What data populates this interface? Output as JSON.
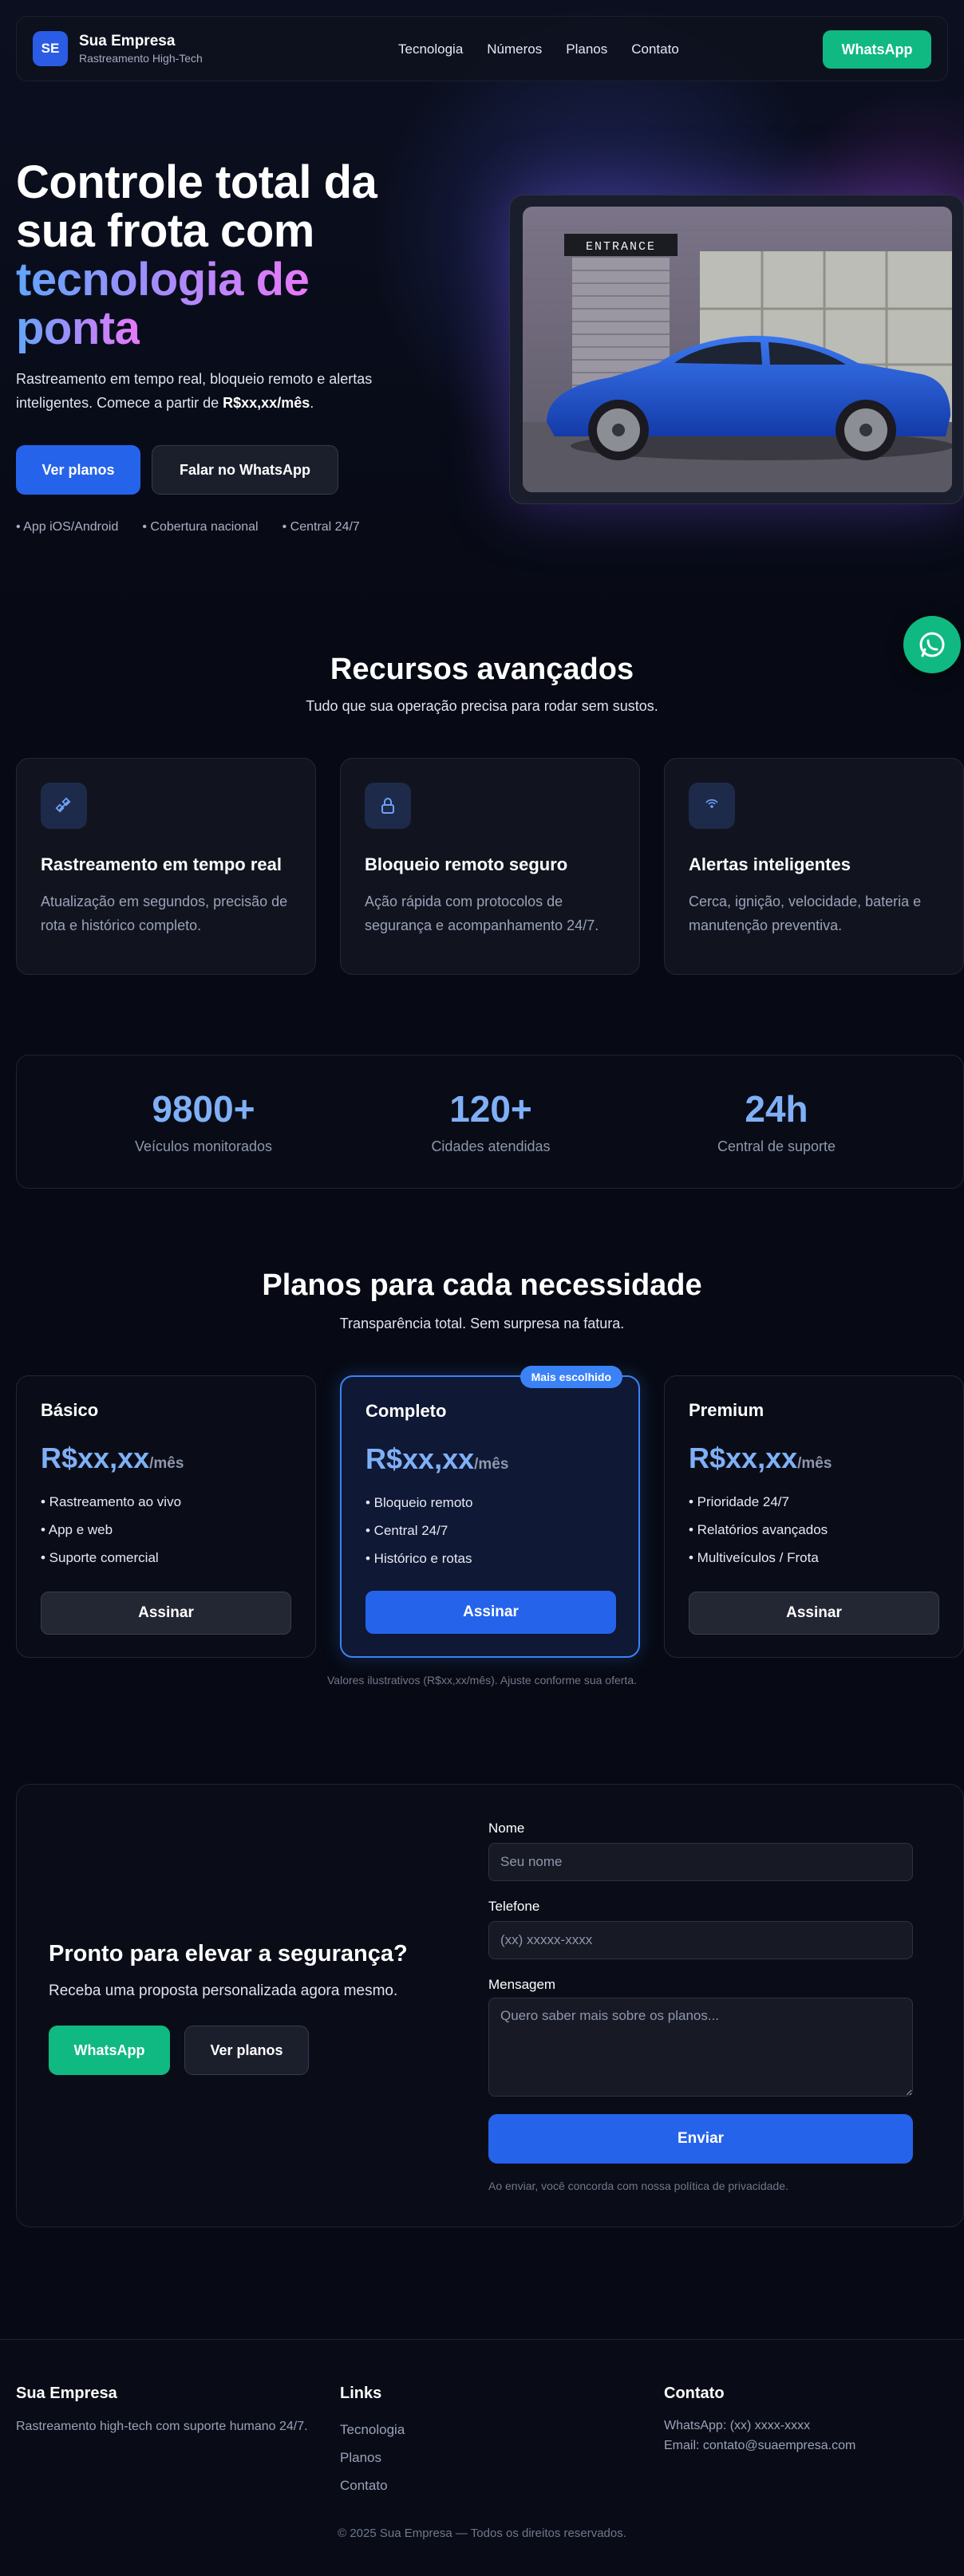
{
  "nav": {
    "logo_initials": "SE",
    "brand_name": "Sua Empresa",
    "brand_sub": "Rastreamento High-Tech",
    "links": [
      "Tecnologia",
      "Números",
      "Planos",
      "Contato"
    ],
    "whatsapp_label": "WhatsApp"
  },
  "hero": {
    "title_line1": "Controle total da",
    "title_line2": "sua frota com",
    "title_grad1": "tecnologia de",
    "title_grad2": "ponta",
    "desc_before": "Rastreamento em tempo real, bloqueio remoto e alertas inteligentes. Comece a partir de ",
    "desc_price": "R$xx,xx/mês",
    "desc_after": ".",
    "primary_btn": "Ver planos",
    "secondary_btn": "Falar no WhatsApp",
    "badges": [
      "• App iOS/Android",
      "• Cobertura nacional",
      "• Central 24/7"
    ],
    "image_sign": "ENTRANCE"
  },
  "features": {
    "title": "Recursos avançados",
    "subtitle": "Tudo que sua operação precisa para rodar sem sustos.",
    "items": [
      {
        "title": "Rastreamento em tempo real",
        "desc": "Atualização em segundos, precisão de rota e histórico completo.",
        "icon": "satellite-icon"
      },
      {
        "title": "Bloqueio remoto seguro",
        "desc": "Ação rápida com protocolos de segurança e acompanhamento 24/7.",
        "icon": "lock-icon"
      },
      {
        "title": "Alertas inteligentes",
        "desc": "Cerca, ignição, velocidade, bateria e manutenção preventiva.",
        "icon": "signal-icon"
      }
    ]
  },
  "stats": [
    {
      "value": "9800+",
      "label": "Veículos monitorados"
    },
    {
      "value": "120+",
      "label": "Cidades atendidas"
    },
    {
      "value": "24h",
      "label": "Central de suporte"
    }
  ],
  "plans": {
    "title": "Planos para cada necessidade",
    "subtitle": "Transparência total. Sem surpresa na fatura.",
    "badge": "Mais escolhido",
    "items": [
      {
        "name": "Básico",
        "price": "R$xx,xx",
        "period": "/mês",
        "features": [
          "• Rastreamento ao vivo",
          "• App e web",
          "• Suporte comercial"
        ],
        "button": "Assinar"
      },
      {
        "name": "Completo",
        "price": "R$xx,xx",
        "period": "/mês",
        "features": [
          "• Bloqueio remoto",
          "• Central 24/7",
          "• Histórico e rotas"
        ],
        "button": "Assinar"
      },
      {
        "name": "Premium",
        "price": "R$xx,xx",
        "period": "/mês",
        "features": [
          "• Prioridade 24/7",
          "• Relatórios avançados",
          "• Multiveículos / Frota"
        ],
        "button": "Assinar"
      }
    ],
    "note": "Valores ilustrativos (R$xx,xx/mês). Ajuste conforme sua oferta."
  },
  "cta": {
    "title": "Pronto para elevar a segurança?",
    "subtitle": "Receba uma proposta personalizada agora mesmo.",
    "whatsapp_btn": "WhatsApp",
    "plans_btn": "Ver planos",
    "form": {
      "name_label": "Nome",
      "name_placeholder": "Seu nome",
      "phone_label": "Telefone",
      "phone_placeholder": "(xx) xxxxx-xxxx",
      "message_label": "Mensagem",
      "message_placeholder": "Quero saber mais sobre os planos...",
      "submit": "Enviar",
      "note": "Ao enviar, você concorda com nossa política de privacidade."
    }
  },
  "footer": {
    "brand": "Sua Empresa",
    "brand_desc": "Rastreamento high-tech com suporte humano 24/7.",
    "links_title": "Links",
    "links": [
      "Tecnologia",
      "Planos",
      "Contato"
    ],
    "contact_title": "Contato",
    "contact_whatsapp": "WhatsApp: (xx) xxxx-xxxx",
    "contact_email": "Email: contato@suaempresa.com",
    "copyright": "© 2025 Sua Empresa — Todos os direitos reservados."
  },
  "colors": {
    "background": "#070a14",
    "primary": "#2563eb",
    "whatsapp": "#10b981",
    "stat_accent": "#7fb0f7",
    "gradient": [
      "#60a5fa",
      "#a78bfa",
      "#e879f9"
    ]
  }
}
